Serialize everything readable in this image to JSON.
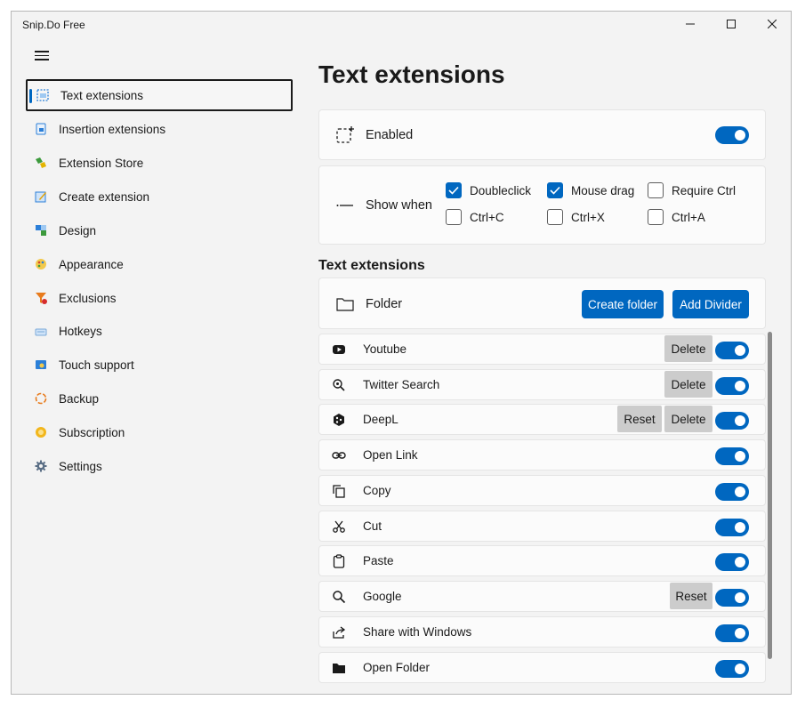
{
  "app": {
    "title": "Snip.Do Free"
  },
  "window_controls": {
    "minimize": "minimize-icon",
    "maximize": "maximize-icon",
    "close": "close-icon"
  },
  "sidebar": {
    "items": [
      {
        "label": "Text extensions",
        "icon": "text-extensions-icon",
        "selected": true
      },
      {
        "label": "Insertion extensions",
        "icon": "insertion-extensions-icon"
      },
      {
        "label": "Extension Store",
        "icon": "extension-store-icon"
      },
      {
        "label": "Create extension",
        "icon": "create-extension-icon"
      },
      {
        "label": "Design",
        "icon": "design-icon"
      },
      {
        "label": "Appearance",
        "icon": "appearance-icon"
      },
      {
        "label": "Exclusions",
        "icon": "exclusions-icon"
      },
      {
        "label": "Hotkeys",
        "icon": "hotkeys-icon"
      },
      {
        "label": "Touch support",
        "icon": "touch-support-icon"
      },
      {
        "label": "Backup",
        "icon": "backup-icon"
      },
      {
        "label": "Subscription",
        "icon": "subscription-icon"
      },
      {
        "label": "Settings",
        "icon": "gear-icon"
      }
    ]
  },
  "main": {
    "title": "Text extensions",
    "enabled": {
      "label": "Enabled",
      "on": true
    },
    "show_when": {
      "label": "Show when",
      "options": [
        {
          "label": "Doubleclick",
          "checked": true
        },
        {
          "label": "Mouse drag",
          "checked": true
        },
        {
          "label": "Require Ctrl",
          "checked": false
        },
        {
          "label": "Ctrl+C",
          "checked": false
        },
        {
          "label": "Ctrl+X",
          "checked": false
        },
        {
          "label": "Ctrl+A",
          "checked": false
        }
      ]
    },
    "section_title": "Text extensions",
    "folder": {
      "label": "Folder",
      "create_folder": "Create folder",
      "add_divider": "Add Divider"
    },
    "extensions": [
      {
        "label": "Youtube",
        "icon": "youtube-icon",
        "delete": "Delete",
        "on": true
      },
      {
        "label": "Twitter Search",
        "icon": "magnifier-icon",
        "delete": "Delete",
        "on": true
      },
      {
        "label": "DeepL",
        "icon": "deepl-icon",
        "reset": "Reset",
        "delete": "Delete",
        "on": true
      },
      {
        "label": "Open Link",
        "icon": "link-icon",
        "on": true
      },
      {
        "label": "Copy",
        "icon": "copy-icon",
        "on": true
      },
      {
        "label": "Cut",
        "icon": "scissors-icon",
        "on": true
      },
      {
        "label": "Paste",
        "icon": "clipboard-icon",
        "on": true
      },
      {
        "label": "Google",
        "icon": "search-icon",
        "reset": "Reset",
        "on": true
      },
      {
        "label": "Share with Windows",
        "icon": "share-icon",
        "on": true
      },
      {
        "label": "Open Folder",
        "icon": "folder-icon",
        "on": true
      }
    ]
  },
  "colors": {
    "accent": "#0067c0",
    "window_bg": "#f3f3f3",
    "card_bg": "#fbfbfb",
    "grey_button": "#cccccc"
  }
}
